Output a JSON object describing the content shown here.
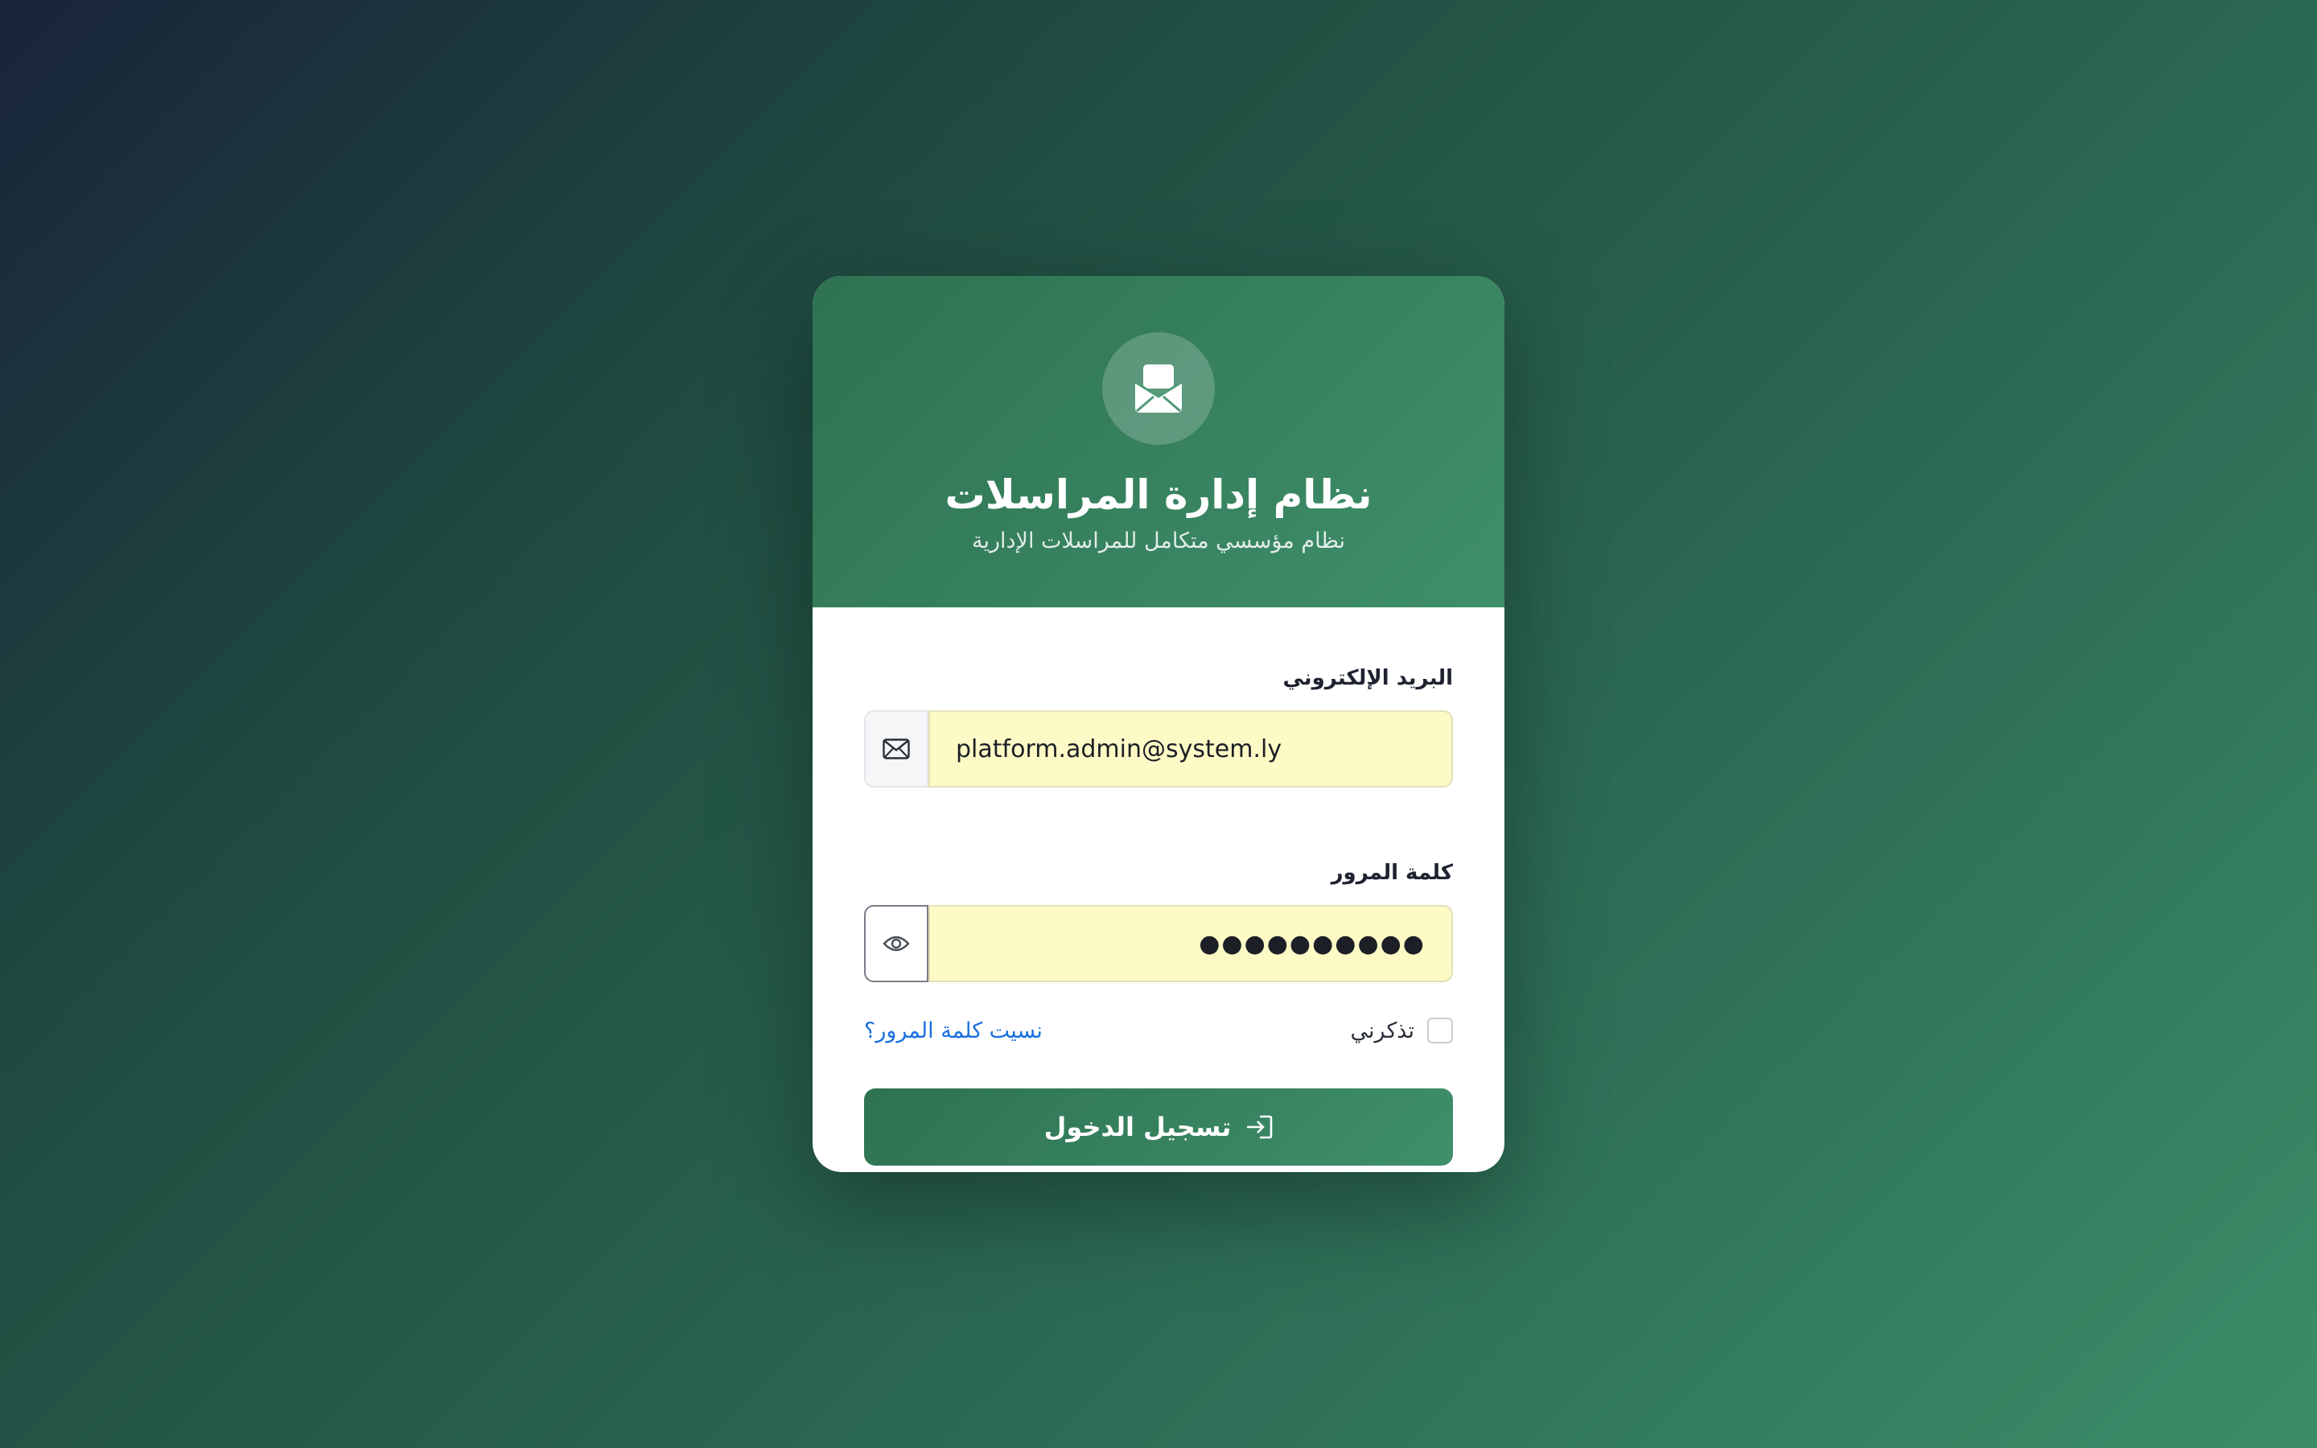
{
  "header": {
    "logo_icon": "envelope-open-icon",
    "title": "نظام إدارة المراسلات",
    "subtitle": "نظام مؤسسي متكامل للمراسلات الإدارية"
  },
  "form": {
    "email": {
      "label": "البريد الإلكتروني",
      "value": "platform.admin@system.ly",
      "icon": "envelope-icon"
    },
    "password": {
      "label": "كلمة المرور",
      "masked_value": "●●●●●●●●●●",
      "toggle_icon": "eye-icon"
    },
    "remember_label": "تذكرني",
    "remember_checked": false,
    "forgot_label": "نسيت كلمة المرور؟",
    "submit_label": "تسجيل الدخول",
    "submit_icon": "sign-in-icon"
  },
  "colors": {
    "brand_green": "#2e7252",
    "brand_green_light": "#3f8f6b",
    "autofill_yellow": "#fefac6",
    "link_blue": "#1a6fe0"
  }
}
